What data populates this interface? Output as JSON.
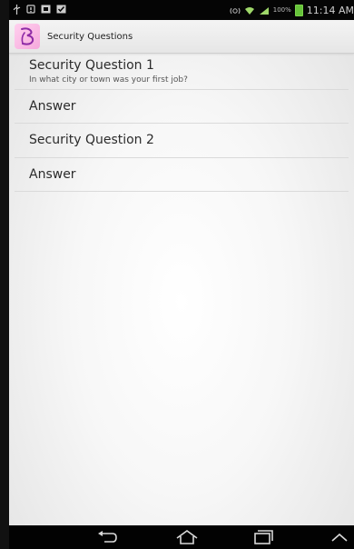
{
  "status_bar": {
    "time": "11:14 AM",
    "battery": "100%",
    "icons": [
      "usb-icon",
      "alert-icon",
      "media-icon",
      "checkbox-icon",
      "nfc-icon",
      "wifi-icon",
      "signal-icon",
      "battery-icon"
    ]
  },
  "action_bar": {
    "title": "Security Questions",
    "logo": "app-logo-icon"
  },
  "form": {
    "question1_title": "Security Question 1",
    "question1_value": "In what city or town was your first job?",
    "answer1_placeholder": "Answer",
    "question2_title": "Security Question 2",
    "answer2_placeholder": "Answer"
  },
  "nav_bar": {
    "buttons": [
      "back-icon",
      "home-icon",
      "recent-apps-icon",
      "menu-up-icon"
    ]
  },
  "colors": {
    "status_bar_bg": "#050505",
    "action_bar_bg": "#eeeeee",
    "text": "#2b2b2b",
    "battery": "#66c33a",
    "logo_bg": "#f6a8dc",
    "logo_stroke": "#8e2aa6"
  }
}
